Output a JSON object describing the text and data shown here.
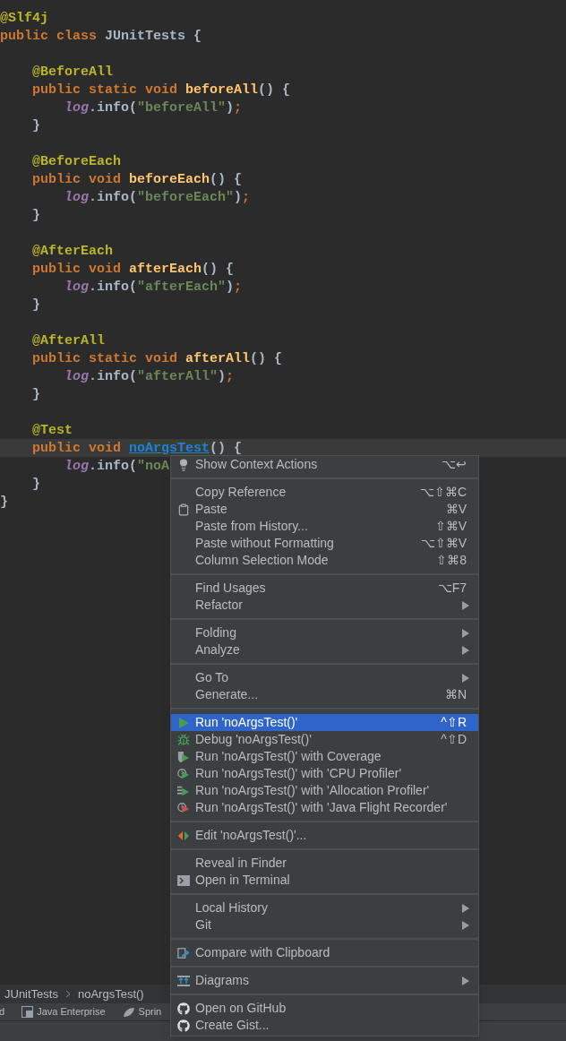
{
  "editor": {
    "lines": [
      {
        "kind": "code",
        "current": false,
        "tokens": [
          {
            "text": "@Slf4j",
            "kind": "annotation"
          }
        ]
      },
      {
        "kind": "code",
        "current": false,
        "tokens": [
          {
            "text": "public class",
            "kind": "keyword"
          },
          {
            "text": " JUnitTests {",
            "kind": "plain"
          }
        ]
      },
      {
        "kind": "blank",
        "current": false
      },
      {
        "kind": "code",
        "current": false,
        "tokens": [
          {
            "text": "    @BeforeAll",
            "kind": "annotation"
          }
        ]
      },
      {
        "kind": "code",
        "current": false,
        "tokens": [
          {
            "text": "    public static void ",
            "kind": "keyword"
          },
          {
            "text": "beforeAll",
            "kind": "declaration"
          },
          {
            "text": "() {",
            "kind": "plain"
          }
        ]
      },
      {
        "kind": "code",
        "current": false,
        "tokens": [
          {
            "text": "        log",
            "kind": "field"
          },
          {
            "text": ".info(",
            "kind": "plain"
          },
          {
            "text": "\"beforeAll\"",
            "kind": "string"
          },
          {
            "text": ")",
            "kind": "plain"
          },
          {
            "text": ";",
            "kind": "semicolon"
          }
        ]
      },
      {
        "kind": "code",
        "current": false,
        "tokens": [
          {
            "text": "    }",
            "kind": "plain"
          }
        ]
      },
      {
        "kind": "blank",
        "current": false
      },
      {
        "kind": "code",
        "current": false,
        "tokens": [
          {
            "text": "    @BeforeEach",
            "kind": "annotation"
          }
        ]
      },
      {
        "kind": "code",
        "current": false,
        "tokens": [
          {
            "text": "    public void ",
            "kind": "keyword"
          },
          {
            "text": "beforeEach",
            "kind": "declaration"
          },
          {
            "text": "() {",
            "kind": "plain"
          }
        ]
      },
      {
        "kind": "code",
        "current": false,
        "tokens": [
          {
            "text": "        log",
            "kind": "field"
          },
          {
            "text": ".info(",
            "kind": "plain"
          },
          {
            "text": "\"beforeEach\"",
            "kind": "string"
          },
          {
            "text": ")",
            "kind": "plain"
          },
          {
            "text": ";",
            "kind": "semicolon"
          }
        ]
      },
      {
        "kind": "code",
        "current": false,
        "tokens": [
          {
            "text": "    }",
            "kind": "plain"
          }
        ]
      },
      {
        "kind": "blank",
        "current": false
      },
      {
        "kind": "code",
        "current": false,
        "tokens": [
          {
            "text": "    @AfterEach",
            "kind": "annotation"
          }
        ]
      },
      {
        "kind": "code",
        "current": false,
        "tokens": [
          {
            "text": "    public void ",
            "kind": "keyword"
          },
          {
            "text": "afterEach",
            "kind": "declaration"
          },
          {
            "text": "() {",
            "kind": "plain"
          }
        ]
      },
      {
        "kind": "code",
        "current": false,
        "tokens": [
          {
            "text": "        log",
            "kind": "field"
          },
          {
            "text": ".info(",
            "kind": "plain"
          },
          {
            "text": "\"afterEach\"",
            "kind": "string"
          },
          {
            "text": ")",
            "kind": "plain"
          },
          {
            "text": ";",
            "kind": "semicolon"
          }
        ]
      },
      {
        "kind": "code",
        "current": false,
        "tokens": [
          {
            "text": "    }",
            "kind": "plain"
          }
        ]
      },
      {
        "kind": "blank",
        "current": false
      },
      {
        "kind": "code",
        "current": false,
        "tokens": [
          {
            "text": "    @AfterAll",
            "kind": "annotation"
          }
        ]
      },
      {
        "kind": "code",
        "current": false,
        "tokens": [
          {
            "text": "    public static void ",
            "kind": "keyword"
          },
          {
            "text": "afterAll",
            "kind": "declaration"
          },
          {
            "text": "() {",
            "kind": "plain"
          }
        ]
      },
      {
        "kind": "code",
        "current": false,
        "tokens": [
          {
            "text": "        log",
            "kind": "field"
          },
          {
            "text": ".info(",
            "kind": "plain"
          },
          {
            "text": "\"afterAll\"",
            "kind": "string"
          },
          {
            "text": ")",
            "kind": "plain"
          },
          {
            "text": ";",
            "kind": "semicolon"
          }
        ]
      },
      {
        "kind": "code",
        "current": false,
        "tokens": [
          {
            "text": "    }",
            "kind": "plain"
          }
        ]
      },
      {
        "kind": "blank",
        "current": false
      },
      {
        "kind": "code",
        "current": false,
        "tokens": [
          {
            "text": "    @Test",
            "kind": "annotation"
          }
        ]
      },
      {
        "kind": "code",
        "current": true,
        "tokens": [
          {
            "text": "    public void ",
            "kind": "keyword"
          },
          {
            "text": "noArgsTest",
            "kind": "usage"
          },
          {
            "text": "() {",
            "kind": "plain"
          }
        ]
      },
      {
        "kind": "code",
        "current": false,
        "tokens": [
          {
            "text": "        log",
            "kind": "field"
          },
          {
            "text": ".info(",
            "kind": "plain"
          },
          {
            "text": "\"noA",
            "kind": "string"
          }
        ]
      },
      {
        "kind": "code",
        "current": false,
        "tokens": [
          {
            "text": "    }",
            "kind": "plain"
          }
        ]
      },
      {
        "kind": "code",
        "current": false,
        "tokens": [
          {
            "text": "}",
            "kind": "plain"
          }
        ]
      }
    ]
  },
  "context_menu": {
    "groups": [
      [
        {
          "label": "Show Context Actions",
          "shortcut": "⌥↩",
          "kind": "bulb",
          "submenu": false,
          "selected": false
        }
      ],
      [
        {
          "label": "Copy Reference",
          "shortcut": "⌥⇧⌘C",
          "kind": "plain",
          "submenu": false,
          "selected": false
        },
        {
          "label": "Paste",
          "shortcut": "⌘V",
          "kind": "clipboard",
          "submenu": false,
          "selected": false
        },
        {
          "label": "Paste from History...",
          "shortcut": "⇧⌘V",
          "kind": "plain",
          "submenu": false,
          "selected": false
        },
        {
          "label": "Paste without Formatting",
          "shortcut": "⌥⇧⌘V",
          "kind": "plain",
          "submenu": false,
          "selected": false
        },
        {
          "label": "Column Selection Mode",
          "shortcut": "⇧⌘8",
          "kind": "plain",
          "submenu": false,
          "selected": false
        }
      ],
      [
        {
          "label": "Find Usages",
          "shortcut": "⌥F7",
          "kind": "plain",
          "submenu": false,
          "selected": false
        },
        {
          "label": "Refactor",
          "kind": "plain",
          "submenu": true,
          "selected": false
        }
      ],
      [
        {
          "label": "Folding",
          "kind": "plain",
          "submenu": true,
          "selected": false
        },
        {
          "label": "Analyze",
          "kind": "plain",
          "submenu": true,
          "selected": false
        }
      ],
      [
        {
          "label": "Go To",
          "kind": "plain",
          "submenu": true,
          "selected": false
        },
        {
          "label": "Generate...",
          "shortcut": "⌘N",
          "kind": "plain",
          "submenu": false,
          "selected": false
        }
      ],
      [
        {
          "label": "Run 'noArgsTest()'",
          "shortcut": "^⇧R",
          "kind": "run",
          "submenu": false,
          "selected": true
        },
        {
          "label": "Debug 'noArgsTest()'",
          "shortcut": "^⇧D",
          "kind": "debug",
          "submenu": false,
          "selected": false
        },
        {
          "label": "Run 'noArgsTest()' with Coverage",
          "kind": "coverage",
          "submenu": false,
          "selected": false
        },
        {
          "label": "Run 'noArgsTest()' with 'CPU Profiler'",
          "kind": "cpu-profiler",
          "submenu": false,
          "selected": false
        },
        {
          "label": "Run 'noArgsTest()' with 'Allocation Profiler'",
          "kind": "allocation-profiler",
          "submenu": false,
          "selected": false
        },
        {
          "label": "Run 'noArgsTest()' with 'Java Flight Recorder'",
          "kind": "flight-recorder",
          "submenu": false,
          "selected": false
        }
      ],
      [
        {
          "label": "Edit 'noArgsTest()'...",
          "kind": "edit",
          "submenu": false,
          "selected": false
        }
      ],
      [
        {
          "label": "Reveal in Finder",
          "kind": "plain",
          "submenu": false,
          "selected": false
        },
        {
          "label": "Open in Terminal",
          "kind": "terminal",
          "submenu": false,
          "selected": false
        }
      ],
      [
        {
          "label": "Local History",
          "kind": "plain",
          "submenu": true,
          "selected": false
        },
        {
          "label": "Git",
          "kind": "plain",
          "submenu": true,
          "selected": false
        }
      ],
      [
        {
          "label": "Compare with Clipboard",
          "kind": "compare",
          "submenu": false,
          "selected": false
        }
      ],
      [
        {
          "label": "Diagrams",
          "kind": "diagrams",
          "submenu": true,
          "selected": false
        }
      ],
      [
        {
          "label": "Open on GitHub",
          "kind": "github",
          "submenu": false,
          "selected": false
        },
        {
          "label": "Create Gist...",
          "kind": "github",
          "submenu": false,
          "selected": false
        }
      ]
    ]
  },
  "breadcrumbs": [
    "JUnitTests",
    "noArgsTest()"
  ],
  "tool_tabs": [
    {
      "label": "d",
      "kind": "plain"
    },
    {
      "label": "Java Enterprise",
      "kind": "enterprise"
    },
    {
      "label": "Sprin",
      "kind": "leaf"
    }
  ]
}
